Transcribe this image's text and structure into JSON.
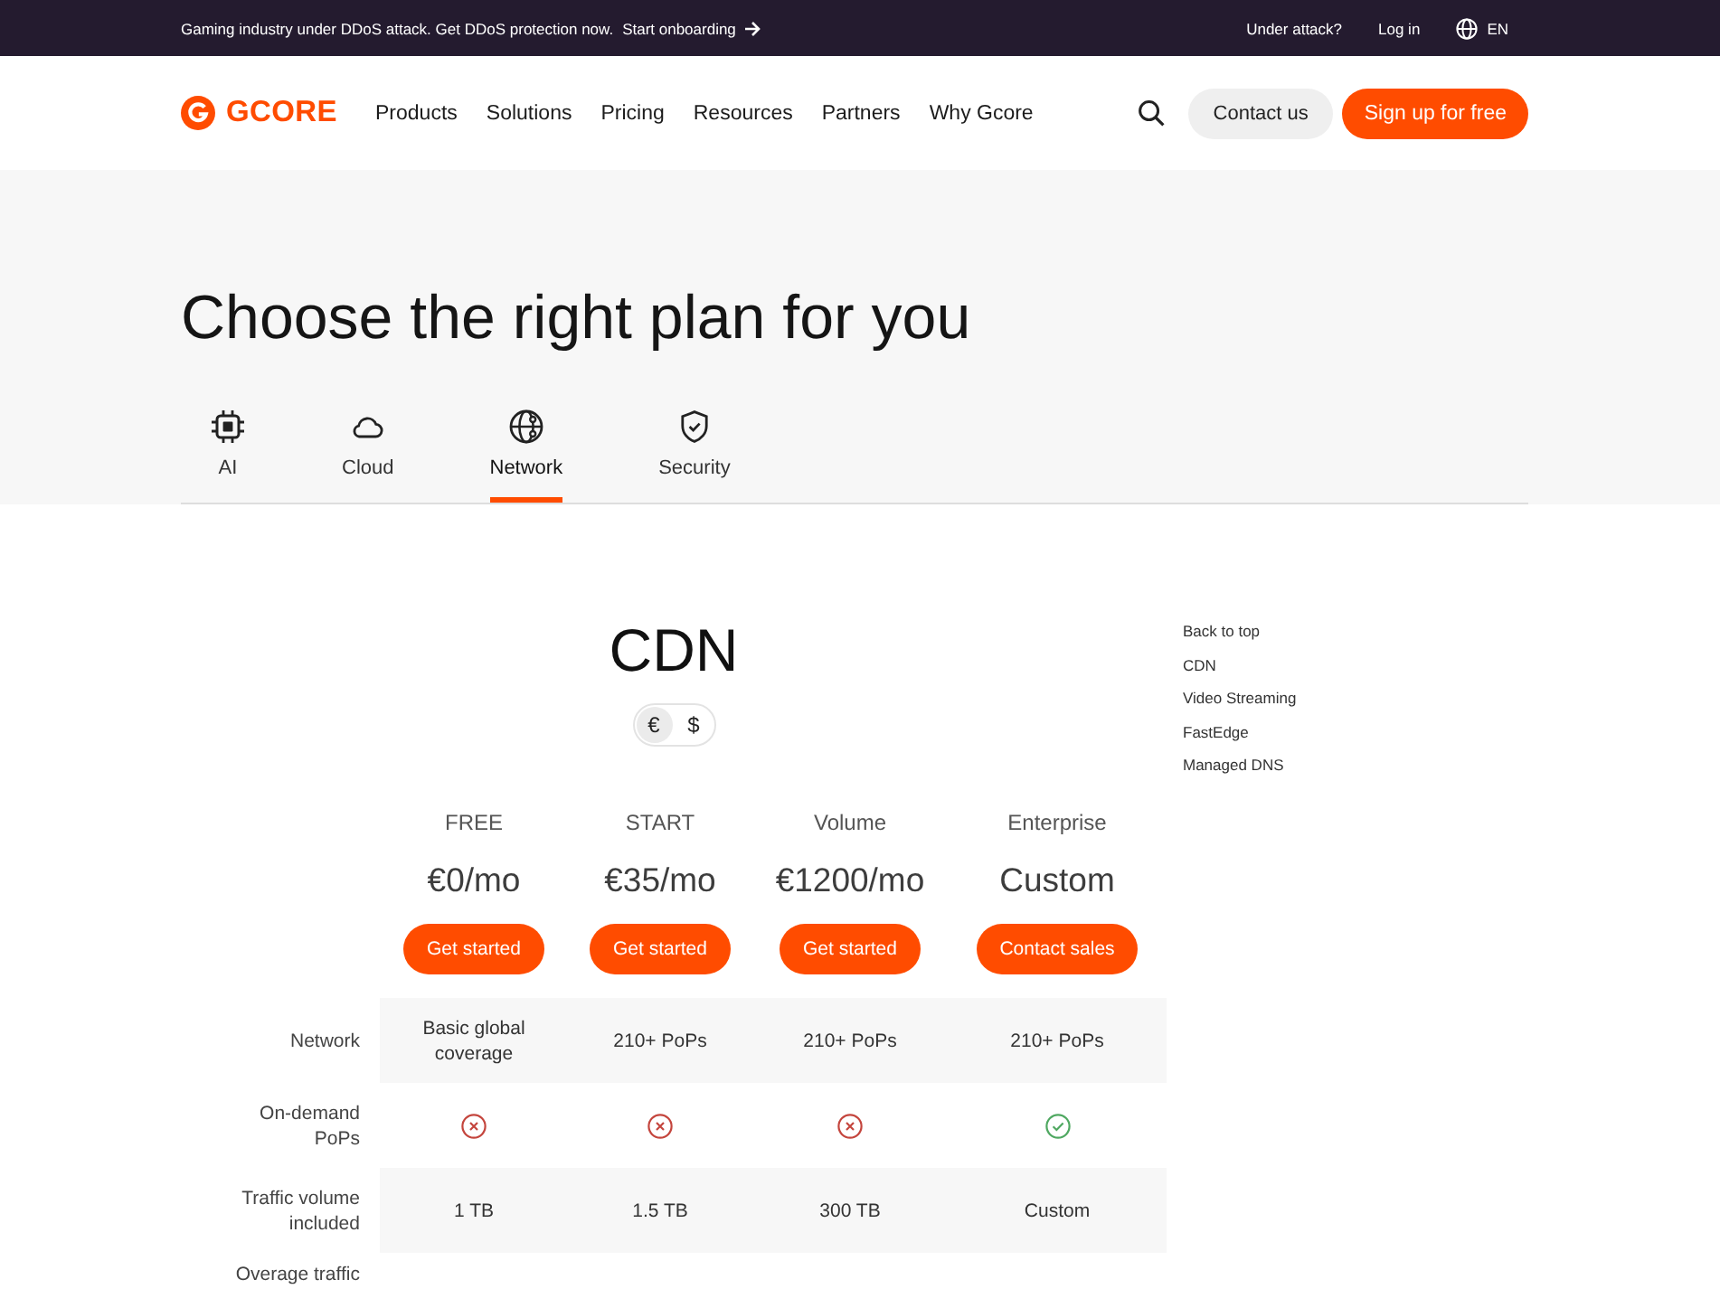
{
  "announcement_bar": {
    "message": "Gaming industry under DDoS attack. Get DDoS protection now.",
    "link": "Start onboarding",
    "links": [
      "Under attack?",
      "Log in"
    ],
    "language": "EN"
  },
  "header": {
    "logo": "GCORE",
    "nav_items": [
      "Products",
      "Solutions",
      "Pricing",
      "Resources",
      "Partners",
      "Why Gcore"
    ],
    "buttons": [
      {
        "label": "Contact us",
        "kind": "secondary"
      },
      {
        "label": "Sign up for free",
        "kind": "primary"
      }
    ]
  },
  "hero": {
    "title": "Choose the right plan for you",
    "tabs": [
      {
        "label": "AI",
        "selected": false
      },
      {
        "label": "Cloud",
        "selected": false
      },
      {
        "label": "Network",
        "selected": true
      },
      {
        "label": "Security",
        "selected": false
      }
    ]
  },
  "product": {
    "title": "CDN",
    "currencies": [
      {
        "symbol": "€",
        "selected": true
      },
      {
        "symbol": "$",
        "selected": false
      }
    ],
    "plans": [
      {
        "name": "FREE",
        "price": "€0/mo",
        "button": "Get started"
      },
      {
        "name": "START",
        "price": "€35/mo",
        "button": "Get started"
      },
      {
        "name": "Volume",
        "price": "€1200/mo",
        "button": "Get started"
      },
      {
        "name": "Enterprise",
        "price": "Custom",
        "button": "Contact sales"
      }
    ],
    "rows": [
      {
        "label": "Network",
        "cells": [
          {
            "kind": "text",
            "text": "Basic global coverage"
          },
          {
            "kind": "text",
            "text": "210+ PoPs"
          },
          {
            "kind": "text",
            "text": "210+ PoPs"
          },
          {
            "kind": "text",
            "text": "210+ PoPs"
          }
        ]
      },
      {
        "label": "On-demand PoPs",
        "cells": [
          {
            "kind": "mark",
            "included": false
          },
          {
            "kind": "mark",
            "included": false
          },
          {
            "kind": "mark",
            "included": false
          },
          {
            "kind": "mark",
            "included": true
          }
        ]
      },
      {
        "label": "Traffic volume included",
        "cells": [
          {
            "kind": "text",
            "text": "1 TB"
          },
          {
            "kind": "text",
            "text": "1.5 TB"
          },
          {
            "kind": "text",
            "text": "300 TB"
          },
          {
            "kind": "text",
            "text": "Custom"
          }
        ]
      },
      {
        "label": "Overage traffic"
      }
    ]
  },
  "page_nav": {
    "items": [
      "Back to top",
      "CDN",
      "Video Streaming",
      "FastEdge",
      "Managed DNS"
    ]
  }
}
